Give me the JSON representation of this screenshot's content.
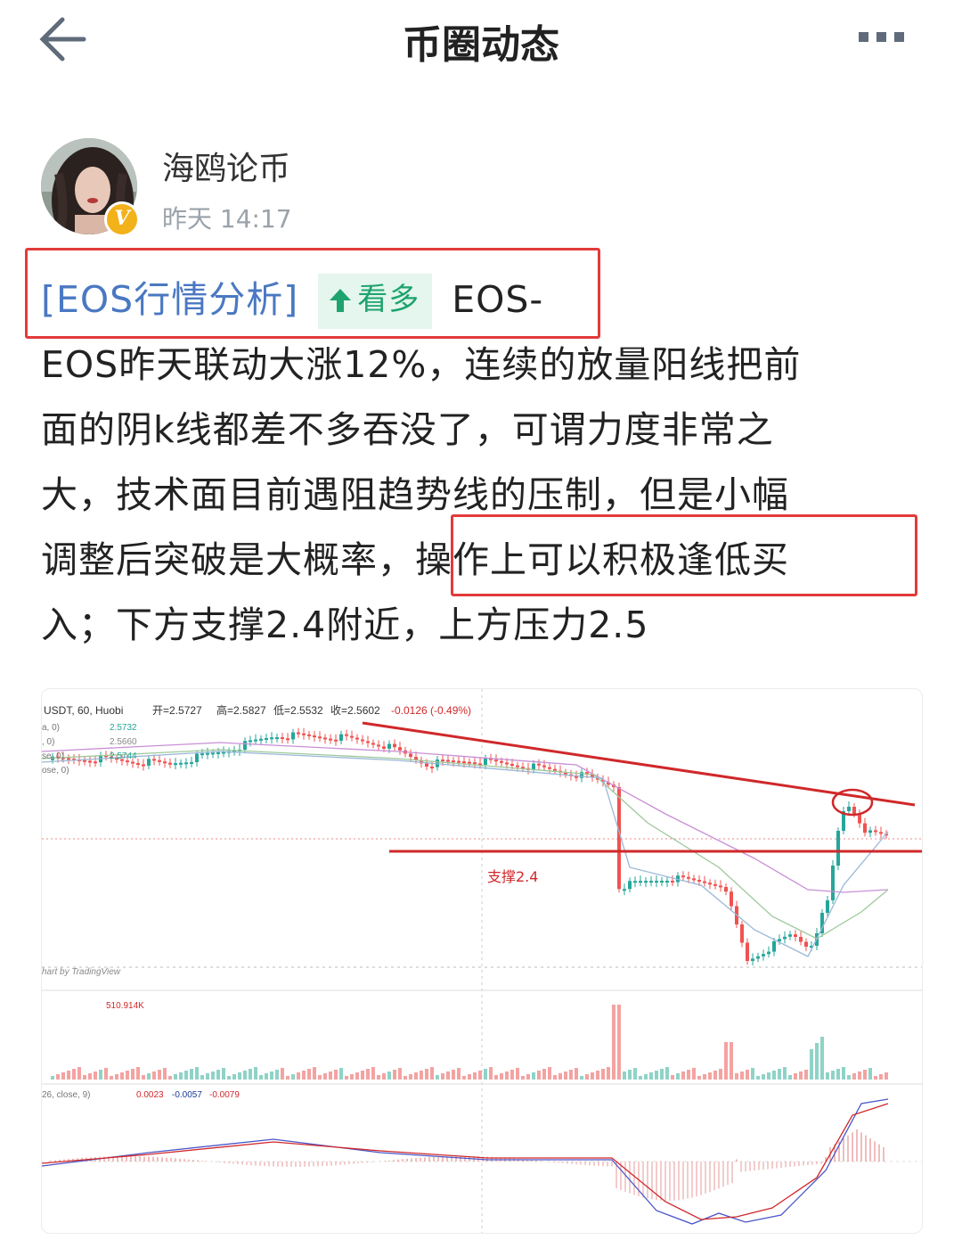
{
  "header": {
    "title": "币圈动态"
  },
  "post": {
    "author": "海鸥论币",
    "time": "昨天 14:17",
    "badge": "V",
    "tag": "[EOS行情分析]",
    "sentiment": "看多",
    "line1_tail": "EOS-",
    "line2": "EOS昨天联动大涨12%，连续的放量阳线把前",
    "line3": "面的阴k线都差不多吞没了，可谓力度非常之",
    "line4": "大，技术面目前遇阻趋势线的压制，但是小幅",
    "line5a": "调整后突破是大概率，",
    "line5b": "操作上可以积极逢低买",
    "line6": "入；下方支撑2.4附近，上方压力2.5"
  },
  "chart": {
    "header": "USDT, 60, Huobi",
    "ohlc": [
      "开=2.5727",
      "高=2.5827",
      "低=2.5532",
      "收=2.5602",
      "-0.0126 (-0.49%)"
    ],
    "ma_rows": [
      "2.5732",
      "2.5660",
      "2.5744"
    ],
    "ma_prefix": [
      "a, 0)",
      ", 0)",
      "se, 0)",
      "ose, 0)"
    ],
    "support_label": "支撑2.4",
    "watermark": "hart by TradingView",
    "volume_label": "510.914K",
    "macd_prefix": "26, close, 9)",
    "macd_values": [
      "0.0023",
      "-0.0057",
      "-0.0079"
    ],
    "colors": {
      "up": "#26a69a",
      "down": "#ef5350",
      "annotation": "#d0282a"
    }
  }
}
